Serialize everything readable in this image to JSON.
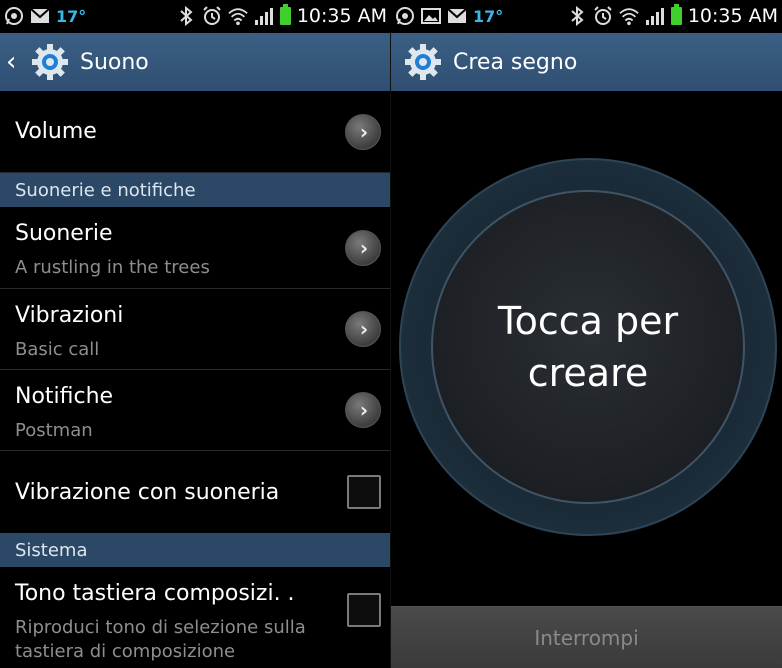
{
  "statusbar": {
    "temperature": "17°",
    "time": "10:35 AM"
  },
  "left": {
    "title": "Suono",
    "rows": {
      "volume": "Volume",
      "section_ringtones": "Suonerie e notifiche",
      "ringtones_title": "Suonerie",
      "ringtones_sub": "A rustling in the trees",
      "vibrations_title": "Vibrazioni",
      "vibrations_sub": "Basic call",
      "notifications_title": "Notifiche",
      "notifications_sub": "Postman",
      "vibrate_ring": "Vibrazione con suoneria",
      "section_system": "Sistema",
      "dial_tone_title": "Tono tastiera composizi. .",
      "dial_tone_sub_1": "Riproduci tono di selezione sulla",
      "dial_tone_sub_2": "tastiera di composizione"
    },
    "vibrate_ring_checked": false,
    "dial_tone_checked": false
  },
  "right": {
    "title": "Crea segno",
    "circle_line_1": "Tocca per",
    "circle_line_2": "creare",
    "stop_button": "Interrompi"
  },
  "colors": {
    "actionbar": "#2f4f72",
    "section_header": "#2c4867",
    "temperature": "#3ab8e8",
    "battery": "#3ecf2f"
  },
  "icons": [
    "whatsapp-icon",
    "gmail-icon",
    "bluetooth-icon",
    "alarm-icon",
    "wifi-icon",
    "signal-icon",
    "battery-icon",
    "gear-icon",
    "chevron-right-icon",
    "back-arrow-icon",
    "gallery-icon"
  ]
}
